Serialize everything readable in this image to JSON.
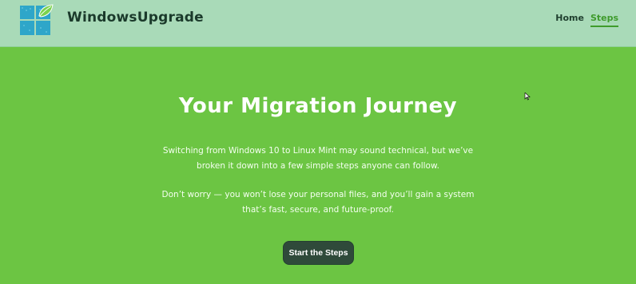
{
  "header": {
    "brand": "WindowsUpgrade",
    "nav": [
      {
        "label": "Home",
        "active": false
      },
      {
        "label": "Steps",
        "active": true
      }
    ]
  },
  "hero": {
    "title": "Your Migration Journey",
    "paragraph_1": "Switching from Windows 10 to Linux Mint may sound technical, but we’ve broken it down into a few simple steps anyone can follow.",
    "paragraph_2": "Don’t worry — you won’t lose your personal files, and you’ll gain a system that’s fast, secure, and future-proof.",
    "cta_label": "Start the Steps"
  },
  "colors": {
    "page_background": "#6cc543",
    "header_background": "#a9dab8",
    "accent": "#3f9b2c",
    "button_background": "#2f4a3a",
    "logo_blue": "#2ea6c9"
  },
  "icons": {
    "logo": "windows-leaf-logo-icon",
    "cursor": "mouse-pointer-icon"
  }
}
